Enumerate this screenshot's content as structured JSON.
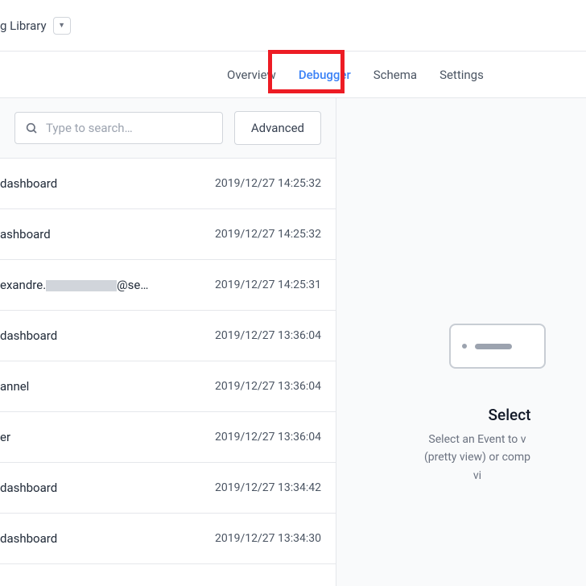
{
  "header": {
    "library_label": "g Library"
  },
  "tabs": {
    "items": [
      {
        "label": "Overview"
      },
      {
        "label": "Debugger"
      },
      {
        "label": "Schema"
      },
      {
        "label": "Settings"
      }
    ]
  },
  "search": {
    "placeholder": "Type to search…",
    "advanced_label": "Advanced"
  },
  "events": [
    {
      "name": "dashboard",
      "time": "2019/12/27 14:25:32"
    },
    {
      "name": "ashboard",
      "time": "2019/12/27 14:25:32"
    },
    {
      "name_prefix": "exandre.",
      "name_suffix": "@se…",
      "time": "2019/12/27 14:25:31",
      "redacted": true
    },
    {
      "name": "dashboard",
      "time": "2019/12/27 13:36:04"
    },
    {
      "name": "annel",
      "time": "2019/12/27 13:36:04"
    },
    {
      "name": "er",
      "time": "2019/12/27 13:36:04"
    },
    {
      "name": "dashboard",
      "time": "2019/12/27 13:34:42"
    },
    {
      "name": "dashboard",
      "time": "2019/12/27 13:34:30"
    }
  ],
  "empty_state": {
    "title": "Select",
    "line1": "Select an Event to v",
    "line2": "(pretty view) or comp",
    "line3": "vi"
  }
}
